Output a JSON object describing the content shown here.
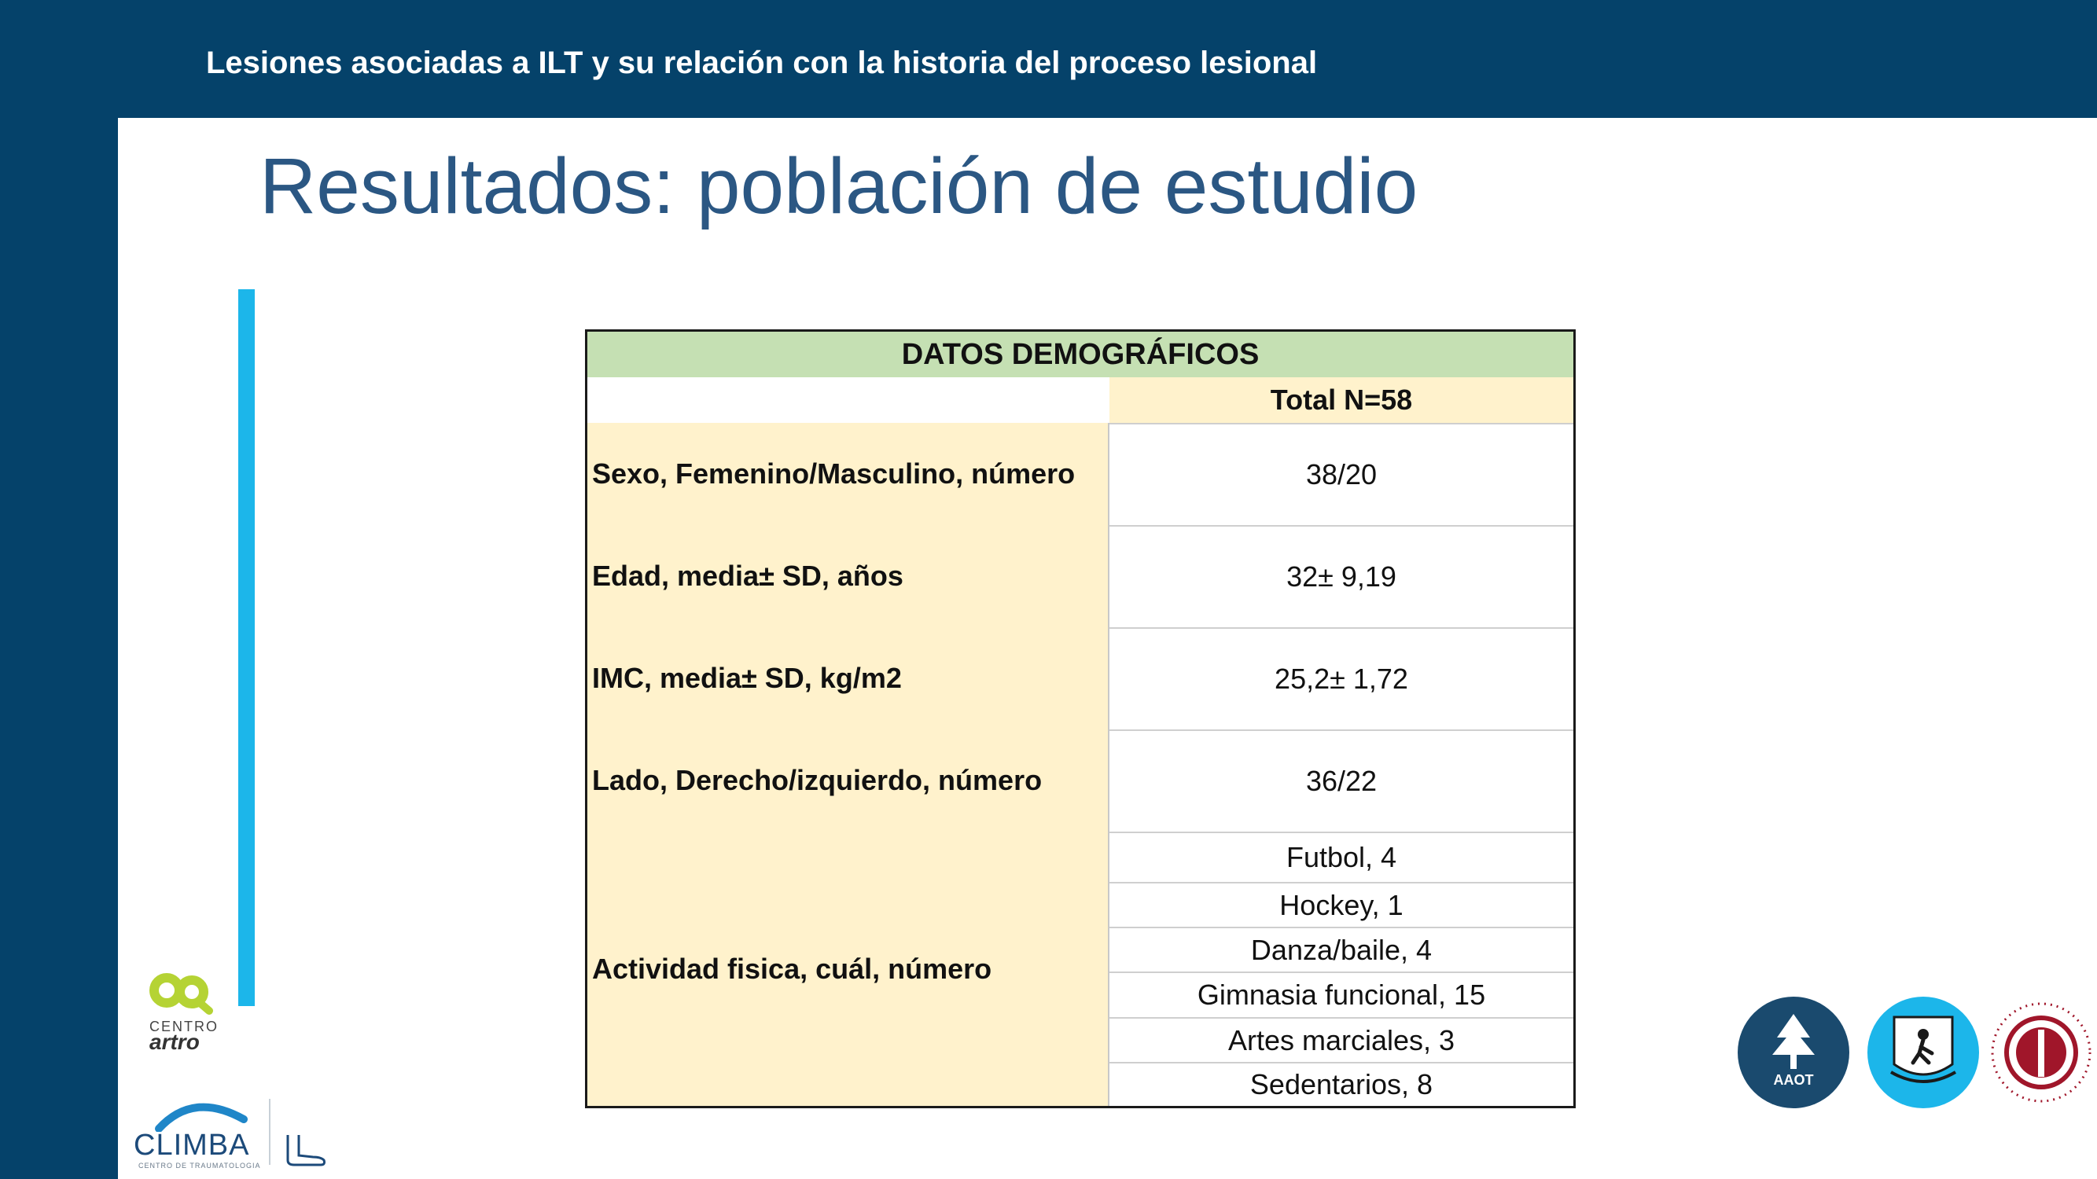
{
  "slide": {
    "header": "Lesiones asociadas a ILT y su relación con la historia del proceso lesional",
    "title": "Resultados: población de estudio"
  },
  "table": {
    "heading": "DATOS DEMOGRÁFICOS",
    "column_header": "Total N=58",
    "rows": [
      {
        "label": "Sexo, Femenino/Masculino, número",
        "value": "38/20"
      },
      {
        "label": "Edad, media± SD, años",
        "value": "32± 9,19"
      },
      {
        "label": "IMC, media± SD, kg/m2",
        "value": "25,2± 1,72"
      },
      {
        "label": "Lado, Derecho/izquierdo, número",
        "value": "36/22"
      }
    ],
    "activity": {
      "label": "Actividad fisica, cuál, número",
      "values": [
        "Futbol, 4",
        "Hockey, 1",
        "Danza/baile, 4",
        "Gimnasia funcional, 15",
        "Artes marciales, 3",
        "Sedentarios, 8"
      ]
    }
  },
  "logos": {
    "arto_line1": "CENTRO",
    "arto_line2": "artro",
    "climba": "CLIMBA",
    "climba_sub": "CENTRO DE TRAUMATOLOGIA",
    "aaot": "AAOT"
  },
  "colors": {
    "bar": "#05426a",
    "title": "#2b5783",
    "accent": "#1cb6ea",
    "table_head": "#c5e0b3",
    "table_label_bg": "#fff2cc"
  }
}
